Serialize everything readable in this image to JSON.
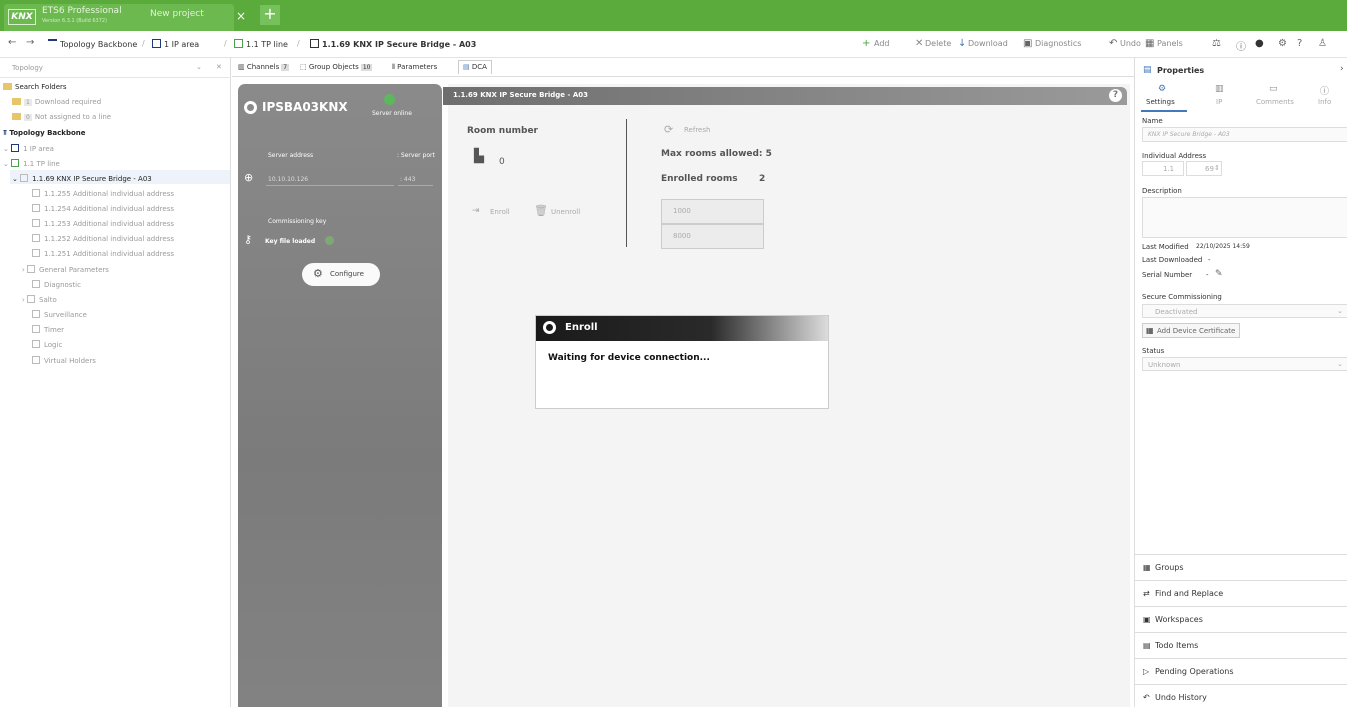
{
  "titlebar": {
    "logo": "KNX",
    "app_name": "ETS6 Professional",
    "app_version": "Version 6.3.1 (Build 6372)",
    "project": "New project",
    "close": "×",
    "plus": "+"
  },
  "breadcrumb": {
    "nav_back": "←",
    "nav_fwd": "→",
    "items": [
      "Topology Backbone",
      "1 IP area",
      "1.1 TP line",
      "1.1.69 KNX IP Secure Bridge - A03"
    ],
    "sep": "/"
  },
  "toolbar": {
    "add": "Add",
    "delete": "Delete",
    "download": "Download",
    "diagnostics": "Diagnostics",
    "undo": "Undo",
    "panels": "Panels"
  },
  "leftpanel": {
    "title": "Topology",
    "search_folders": "Search Folders",
    "download_required": "Download required",
    "download_required_count": "1",
    "not_assigned": "Not assigned to a line",
    "not_assigned_count": "0",
    "topology_backbone": "Topology Backbone",
    "ip_area": "1 IP area",
    "tp_line": "1.1 TP line",
    "device": "1.1.69 KNX IP Secure Bridge - A03",
    "children": [
      "1.1.255 Additional individual address",
      "1.1.254 Additional individual address",
      "1.1.253 Additional individual address",
      "1.1.252 Additional individual address",
      "1.1.251 Additional individual address",
      "General Parameters",
      "Diagnostic",
      "Salto",
      "Surveillance",
      "Timer",
      "Logic",
      "Virtual Holders"
    ]
  },
  "tabs": {
    "channels": "Channels",
    "channels_count": "7",
    "group_objects": "Group Objects",
    "group_objects_count": "10",
    "parameters": "Parameters",
    "dca": "DCA"
  },
  "device": {
    "name": "IPSBA03KNX",
    "status": "Server online",
    "server_address_label": "Server address",
    "server_port_label": ": Server port",
    "server_address": "10.10.10.126",
    "server_port": ": 443",
    "commissioning_key_label": "Commissioning key",
    "key_status": "Key file loaded",
    "configure": "Configure",
    "status_color": "#5cb85c"
  },
  "main": {
    "header": "1.1.69 KNX IP Secure Bridge - A03",
    "help": "?",
    "room_number_label": "Room number",
    "room_number": "0",
    "refresh": "Refresh",
    "max_rooms": "Max rooms allowed: 5",
    "enrolled_rooms_label": "Enrolled rooms",
    "enrolled_rooms": "2",
    "enroll": "Enroll",
    "unenroll": "Unenroll",
    "rooms": [
      "1000",
      "8000"
    ]
  },
  "dialog": {
    "title": "Enroll",
    "message": "Waiting for device connection..."
  },
  "properties": {
    "title": "Properties",
    "tabs": [
      "Settings",
      "IP",
      "Comments",
      "Info"
    ],
    "name_label": "Name",
    "name_placeholder": "KNX IP Secure Bridge - A03",
    "ia_label": "Individual Address",
    "ia_line": "1.1",
    "ia_device": "69",
    "description_label": "Description",
    "last_modified_label": "Last Modified",
    "last_modified": "22/10/2025 14:59",
    "last_downloaded_label": "Last Downloaded",
    "last_downloaded": "-",
    "serial_label": "Serial Number",
    "serial": "-",
    "secure_label": "Secure Commissioning",
    "secure_value": "Deactivated",
    "add_cert": "Add Device Certificate",
    "status_label": "Status",
    "status_value": "Unknown"
  },
  "dock": [
    "Groups",
    "Find and Replace",
    "Workspaces",
    "Todo Items",
    "Pending Operations",
    "Undo History"
  ]
}
